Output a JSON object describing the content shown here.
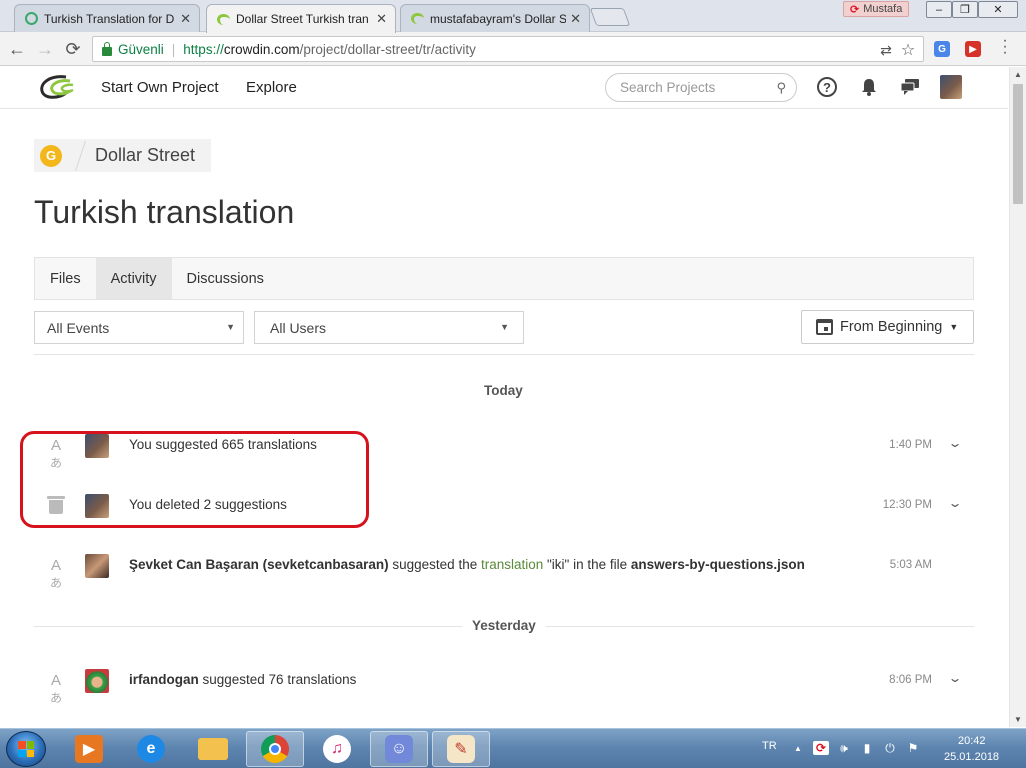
{
  "browser": {
    "tabs": [
      {
        "title": "Turkish Translation for D",
        "active": false
      },
      {
        "title": "Dollar Street Turkish tran",
        "active": true
      },
      {
        "title": "mustafabayram's Dollar S",
        "active": false
      }
    ],
    "profile_name": "Mustafa",
    "secure_label": "Güvenli",
    "url_scheme": "https://",
    "url_host": "crowdin.com",
    "url_path": "/project/dollar-street/tr/activity"
  },
  "header": {
    "nav": [
      "Start Own Project",
      "Explore"
    ],
    "search_placeholder": "Search Projects"
  },
  "breadcrumb": {
    "project_name": "Dollar Street"
  },
  "page_title": "Turkish translation",
  "tabs": [
    {
      "label": "Files",
      "active": false
    },
    {
      "label": "Activity",
      "active": true
    },
    {
      "label": "Discussions",
      "active": false
    }
  ],
  "filters": {
    "events": "All Events",
    "users": "All Users",
    "date": "From Beginning"
  },
  "days": [
    {
      "label": "Today",
      "items": [
        {
          "icon": "translate-icon",
          "text_parts": [
            {
              "t": "You suggested 665 translations"
            }
          ],
          "time": "1:40 PM",
          "expandable": true
        },
        {
          "icon": "trash-icon",
          "text_parts": [
            {
              "t": "You deleted 2 suggestions"
            }
          ],
          "time": "12:30 PM",
          "expandable": true
        },
        {
          "icon": "translate-icon",
          "text_parts": [
            {
              "t": "Şevket Can Başaran (sevketcanbasaran)",
              "style": "bold"
            },
            {
              "t": " suggested the "
            },
            {
              "t": "translation",
              "style": "green"
            },
            {
              "t": " \"iki\" in the file "
            },
            {
              "t": "answers-by-questions.json",
              "style": "bold"
            }
          ],
          "time": "5:03 AM",
          "expandable": false
        }
      ]
    },
    {
      "label": "Yesterday",
      "items": [
        {
          "icon": "translate-icon",
          "text_parts": [
            {
              "t": "irfandogan",
              "style": "bold"
            },
            {
              "t": " suggested 76 translations"
            }
          ],
          "time": "8:06 PM",
          "expandable": true
        }
      ]
    }
  ],
  "taskbar": {
    "language": "TR",
    "time": "20:42",
    "date": "25.01.2018"
  },
  "colors": {
    "highlight": "#d6121f",
    "accent_green": "#5a8a3a",
    "secure_green": "#0b8043"
  }
}
